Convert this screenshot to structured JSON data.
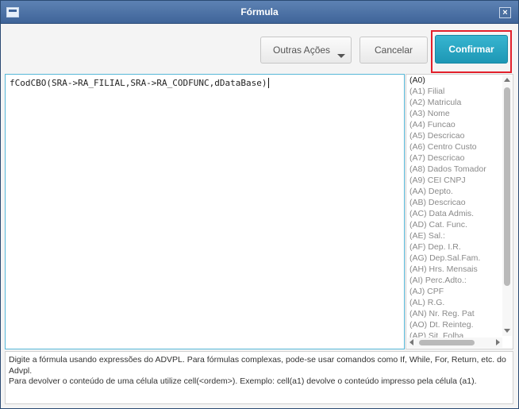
{
  "window": {
    "title": "Fórmula",
    "close_glyph": "×"
  },
  "toolbar": {
    "outras_acoes_label": "Outras Ações",
    "cancelar_label": "Cancelar",
    "confirmar_label": "Confirmar"
  },
  "editor": {
    "value": "fCodCBO(SRA->RA_FILIAL,SRA->RA_CODFUNC,dDataBase)"
  },
  "field_list": {
    "items": [
      "(A0)",
      "(A1) Filial",
      "(A2) Matricula",
      "(A3) Nome",
      "(A4) Funcao",
      "(A5) Descricao",
      "(A6) Centro Custo",
      "(A7) Descricao",
      "(A8) Dados Tomador",
      "(A9) CEI CNPJ",
      "(AA) Depto.",
      "(AB) Descricao",
      "(AC) Data Admis.",
      "(AD) Cat. Func.",
      "(AE) Sal.:",
      "(AF) Dep. I.R.",
      "(AG) Dep.Sal.Fam.",
      "(AH) Hrs. Mensais",
      "(AI) Perc.Adto.:",
      "(AJ) CPF",
      "(AL) R.G.",
      "(AN) Nr. Reg. Pat",
      "(AO) Dt. Reinteg.",
      "(AP) Sit. Folha"
    ]
  },
  "help": {
    "line1": "Digite a fórmula usando expressões do ADVPL. Para fórmulas complexas, pode-se usar comandos como If, While, For, Return, etc. do Advpl.",
    "line2": "Para devolver o conteúdo de uma célula utilize cell(<ordem>). Exemplo: cell(a1) devolve o conteúdo impresso pela célula (a1)."
  },
  "colors": {
    "titlebar": "#4a6fa0",
    "confirm_button": "#2aa6c4",
    "highlight_box": "#e2202b",
    "editor_border": "#56b7d8"
  },
  "icons": {
    "app": "window-icon",
    "close": "close-icon",
    "dropdown": "caret-down-icon"
  }
}
